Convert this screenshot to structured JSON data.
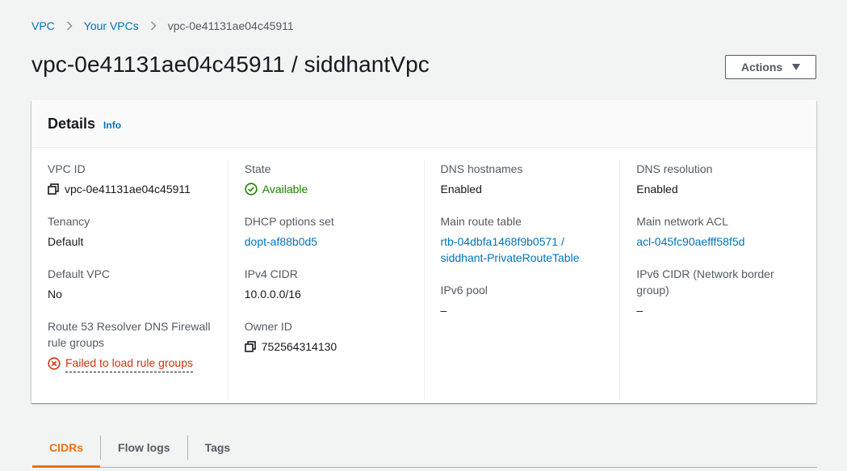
{
  "breadcrumb": {
    "root": "VPC",
    "parent": "Your VPCs",
    "current": "vpc-0e41131ae04c45911"
  },
  "page_title": "vpc-0e41131ae04c45911 / siddhantVpc",
  "actions_label": "Actions",
  "details": {
    "title": "Details",
    "info_label": "Info",
    "col1": {
      "vpc_id_label": "VPC ID",
      "vpc_id_value": "vpc-0e41131ae04c45911",
      "tenancy_label": "Tenancy",
      "tenancy_value": "Default",
      "default_vpc_label": "Default VPC",
      "default_vpc_value": "No",
      "route53_label": "Route 53 Resolver DNS Firewall rule groups",
      "route53_value": "Failed to load rule groups"
    },
    "col2": {
      "state_label": "State",
      "state_value": "Available",
      "dhcp_label": "DHCP options set",
      "dhcp_value": "dopt-af88b0d5",
      "ipv4_label": "IPv4 CIDR",
      "ipv4_value": "10.0.0.0/16",
      "owner_label": "Owner ID",
      "owner_value": "752564314130"
    },
    "col3": {
      "dns_hostnames_label": "DNS hostnames",
      "dns_hostnames_value": "Enabled",
      "main_route_label": "Main route table",
      "main_route_value_1": "rtb-04dbfa1468f9b0571 /",
      "main_route_value_2": "siddhant-PrivateRouteTable",
      "ipv6_pool_label": "IPv6 pool",
      "ipv6_pool_value": "–"
    },
    "col4": {
      "dns_resolution_label": "DNS resolution",
      "dns_resolution_value": "Enabled",
      "main_acl_label": "Main network ACL",
      "main_acl_value": "acl-045fc90aefff58f5d",
      "ipv6_cidr_label": "IPv6 CIDR (Network border group)",
      "ipv6_cidr_value": "–"
    }
  },
  "tabs": [
    {
      "label": "CIDRs",
      "active": true
    },
    {
      "label": "Flow logs",
      "active": false
    },
    {
      "label": "Tags",
      "active": false
    }
  ],
  "colors": {
    "link": "#0073bb",
    "success": "#1d8102",
    "error": "#d13212",
    "accent": "#ec7211"
  },
  "icons": [
    "chevron-right-icon",
    "copy-icon",
    "check-circle-icon",
    "error-circle-icon",
    "caret-down-icon"
  ]
}
